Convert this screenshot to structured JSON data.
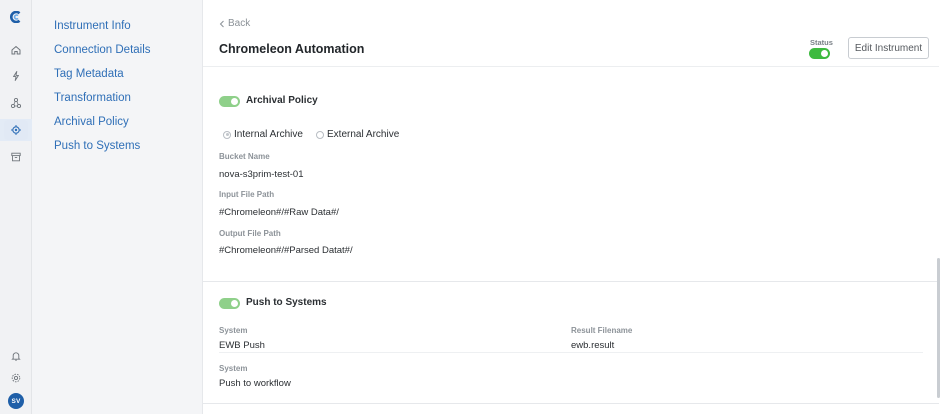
{
  "rail": {
    "icons": [
      "app-logo-icon",
      "home-icon",
      "lightning-icon",
      "network-icon",
      "instrument-icon",
      "archive-box-icon",
      "bell-icon",
      "settings-icon"
    ],
    "avatar_initials": "SV"
  },
  "nav": {
    "items": [
      {
        "label": "Instrument Info"
      },
      {
        "label": "Connection Details"
      },
      {
        "label": "Tag Metadata"
      },
      {
        "label": "Transformation"
      },
      {
        "label": "Archival Policy"
      },
      {
        "label": "Push to Systems"
      }
    ]
  },
  "header": {
    "back_label": "Back",
    "title": "Chromeleon Automation",
    "status_label": "Status",
    "status_on": true,
    "edit_button_label": "Edit Instrument"
  },
  "archival": {
    "title": "Archival Policy",
    "enabled": true,
    "options": [
      {
        "label": "Internal Archive",
        "selected": true
      },
      {
        "label": "External Archive",
        "selected": false
      }
    ],
    "fields": [
      {
        "label": "Bucket Name",
        "value": "nova-s3prim-test-01"
      },
      {
        "label": "Input File Path",
        "value": "#Chromeleon#/#Raw Data#/"
      },
      {
        "label": "Output File Path",
        "value": "#Chromeleon#/#Parsed Datat#/"
      }
    ]
  },
  "push": {
    "title": "Push to Systems",
    "enabled": true,
    "col_system_label": "System",
    "col_result_label": "Result Filename",
    "rows": [
      {
        "system": "EWB Push",
        "result": "ewb.result"
      },
      {
        "system": "Push to workflow",
        "result": ""
      }
    ]
  },
  "colors": {
    "accent": "#2f6fb7",
    "toggle_on": "#3dba3f",
    "avatar_bg": "#1f5fa8"
  }
}
